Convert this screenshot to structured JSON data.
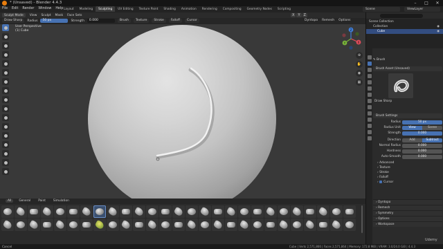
{
  "window": {
    "title": "* (Unsaved) - Blender 4.4.3",
    "controls": [
      "–",
      "□",
      "✕"
    ]
  },
  "menu": [
    "File",
    "Edit",
    "Render",
    "Window",
    "Help"
  ],
  "workspaces": [
    {
      "label": "Layout",
      "active": false
    },
    {
      "label": "Modeling",
      "active": false
    },
    {
      "label": "Sculpting",
      "active": true
    },
    {
      "label": "UV Editing",
      "active": false
    },
    {
      "label": "Texture Paint",
      "active": false
    },
    {
      "label": "Shading",
      "active": false
    },
    {
      "label": "Animation",
      "active": false
    },
    {
      "label": "Rendering",
      "active": false
    },
    {
      "label": "Compositing",
      "active": false
    },
    {
      "label": "Geometry Nodes",
      "active": false
    },
    {
      "label": "Scripting",
      "active": false
    }
  ],
  "top_right": {
    "scene": "Scene",
    "view_layer": "ViewLayer"
  },
  "header": {
    "mode": "Sculpt Mode",
    "menus": [
      "View",
      "Sculpt",
      "Mask",
      "Face Sets"
    ],
    "xyz": [
      "X",
      "Y",
      "Z"
    ],
    "right_items": [
      "Dyntopo",
      "Remesh",
      "Options"
    ]
  },
  "tool_settings": {
    "brush_name": "Draw Sharp",
    "radius_label": "Radius",
    "radius_value": "50 px",
    "strength_label": "Strength",
    "strength_value": "0.000",
    "menus": [
      "Brush",
      "Texture",
      "Stroke",
      "Falloff",
      "Cursor"
    ]
  },
  "viewport": {
    "overlay_line1": "User Perspective",
    "overlay_line2": "(1) Cube",
    "gizmo_labels": [
      "X",
      "Y",
      "Z"
    ],
    "right_buttons": [
      "zoom-icon",
      "hand-icon",
      "camera-icon",
      "grid-icon"
    ]
  },
  "asset_shelf": {
    "tabs": [
      {
        "label": "All",
        "active": true
      },
      {
        "label": "General",
        "active": false
      },
      {
        "label": "Paint",
        "active": false
      },
      {
        "label": "Simulation",
        "active": false
      }
    ],
    "rows": 2,
    "columns": 27,
    "active_index": 7,
    "yellow_index": 34
  },
  "status_bar": {
    "left": "Cancel",
    "right": "Cube | Verts 2,571,866 | Faces 2,571,864 | Memory: 172.8 MiB | VRAM: 3.0/24.0 GiB | 4.4.3"
  },
  "outliner": {
    "rows": [
      {
        "label": "Scene Collection",
        "selected": false,
        "indent": 0
      },
      {
        "label": "Collection",
        "selected": false,
        "indent": 1
      },
      {
        "label": "Cube",
        "selected": true,
        "indent": 2
      }
    ]
  },
  "properties": {
    "section": "Brush",
    "brush_asset_header": "Brush Asset (Unsaved)",
    "brush_name": "Draw Sharp",
    "brush_settings_header": "Brush Settings",
    "rows": {
      "radius": {
        "label": "Radius",
        "value": "50 px"
      },
      "radius_unit": {
        "label": "Radius Unit",
        "options": [
          "View",
          "Scene"
        ],
        "active": 0
      },
      "strength": {
        "label": "Strength",
        "value": "0.000"
      },
      "direction": {
        "label": "Direction",
        "options": [
          "Add",
          "Subtract"
        ],
        "active": 1
      },
      "normal_radius": {
        "label": "Normal Radius",
        "value": "0.000"
      },
      "hardness": {
        "label": "Hardness",
        "value": "0.000"
      },
      "auto_smooth": {
        "label": "Auto-Smooth",
        "value": "0.000"
      }
    },
    "subpanels": [
      "Advanced",
      "Texture",
      "Stroke",
      "Falloff",
      "Cursor"
    ],
    "cursor_checked": true,
    "panels": [
      "Dyntopo",
      "Remesh",
      "Symmetry",
      "Options",
      "Workspace"
    ]
  },
  "watermark": "Udemy",
  "colors": {
    "accent": "#4772b3",
    "selected_row": "#334d80",
    "logo": "#e87d0d"
  }
}
